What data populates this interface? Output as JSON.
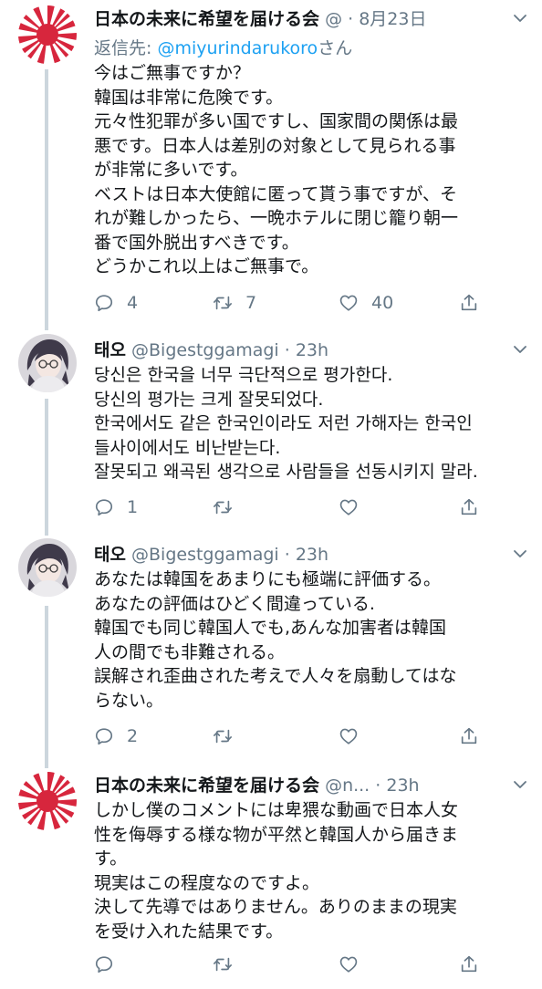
{
  "tweets": [
    {
      "name": "日本の未来に希望を届ける会",
      "handle": "@",
      "sep": "·",
      "time": "8月23日",
      "reply_prefix": "返信先: ",
      "reply_mention": "@miyurindarukoro",
      "reply_suffix": "さん",
      "lines": [
        "今はご無事ですか？",
        "韓国は非常に危険です。",
        "元々性犯罪が多い国ですし、国家間の関係は最",
        "悪です。日本人は差別の対象として見られる事",
        "が非常に多いです。",
        "ベストは日本大使館に匿って貰う事ですが、そ",
        "れが難しかったら、一晩ホテルに閉じ籠り朝一",
        "番で国外脱出すべきです。",
        "どうかこれ以上はご無事で。"
      ],
      "replies": "4",
      "retweets": "7",
      "likes": "40"
    },
    {
      "name": "태오",
      "handle": "@Bigestggamagi",
      "sep": "·",
      "time": "23h",
      "lines": [
        "당신은 한국을 너무 극단적으로 평가한다.",
        "당신의 평가는 크게 잘못되었다.",
        "한국에서도 같은 한국인이라도 저런 가해자는 한국인",
        "들사이에서도 비난받는다.",
        "잘못되고 왜곡된 생각으로 사람들을 선동시키지 말라."
      ],
      "replies": "1",
      "retweets": "",
      "likes": ""
    },
    {
      "name": "태오",
      "handle": "@Bigestggamagi",
      "sep": "·",
      "time": "23h",
      "lines": [
        "あなたは韓国をあまりにも極端に評価する。",
        "あなたの評価はひどく間違っている.",
        "韓国でも同じ韓国人でも,あんな加害者は韓国",
        "人の間でも非難される。",
        "誤解され歪曲された考えで人々を扇動してはな",
        "らない。"
      ],
      "replies": "2",
      "retweets": "",
      "likes": ""
    },
    {
      "name": "日本の未来に希望を届ける会",
      "handle": "@n...",
      "sep": "·",
      "time": "23h",
      "lines": [
        "しかし僕のコメントには卑猥な動画で日本人女",
        "性を侮辱する様な物が平然と韓国人から届きま",
        "す。",
        "現実はこの程度なのですよ。",
        "決して先導ではありません。ありのままの現実",
        "を受け入れた結果です。"
      ],
      "replies": "",
      "retweets": "",
      "likes": ""
    }
  ],
  "icons": {
    "avatar_flag": "rising-sun-flag",
    "avatar_user": "anime-character",
    "caret": "chevron-down",
    "reply": "comment-bubble",
    "retweet": "retweet-arrows",
    "like": "heart",
    "share": "share-arrow"
  },
  "colors": {
    "text": "#14171a",
    "secondary": "#657786",
    "link": "#1da1f2",
    "thread_line": "#ccd6dd",
    "flag_red": "#d7263d"
  }
}
